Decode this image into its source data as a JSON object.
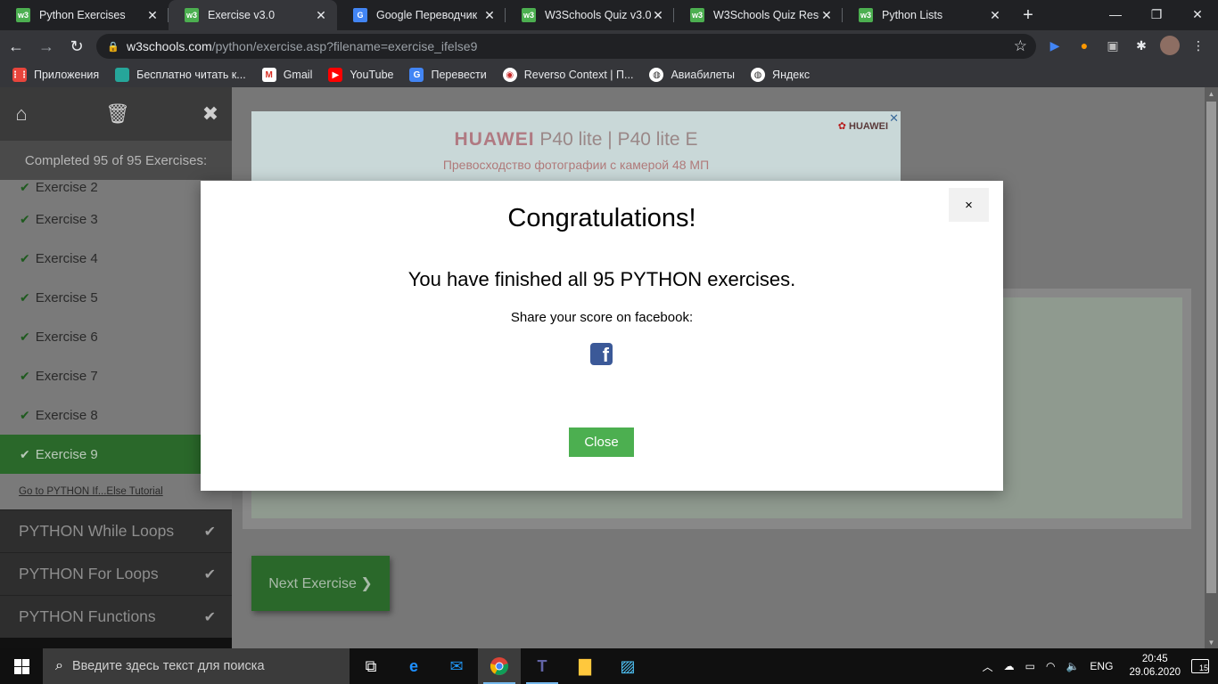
{
  "tabs": [
    {
      "title": "Python Exercises",
      "favicon": "w3"
    },
    {
      "title": "Exercise v3.0",
      "favicon": "w3",
      "active": true
    },
    {
      "title": "Google Переводчик",
      "favicon": "gt"
    },
    {
      "title": "W3Schools Quiz v3.0",
      "favicon": "w3"
    },
    {
      "title": "W3Schools Quiz Result",
      "favicon": "w3"
    },
    {
      "title": "Python Lists",
      "favicon": "w3"
    }
  ],
  "address": {
    "domain": "w3schools.com",
    "path": "/python/exercise.asp?filename=exercise_ifelse9"
  },
  "bookmarks": [
    {
      "label": "Приложения",
      "icon": "apps-grid-icon",
      "color": "#e8453c"
    },
    {
      "label": "Бесплатно читать к...",
      "icon": "book-icon",
      "color": "#26a69a"
    },
    {
      "label": "Gmail",
      "icon": "gmail-icon",
      "color": "#d93025"
    },
    {
      "label": "YouTube",
      "icon": "youtube-icon",
      "color": "#ff0000"
    },
    {
      "label": "Перевести",
      "icon": "translate-icon",
      "color": "#4285f4"
    },
    {
      "label": "Reverso Context | П...",
      "icon": "reverso-icon",
      "color": "#ffffff"
    },
    {
      "label": "Авиабилеты",
      "icon": "globe-icon",
      "color": "#ffffff"
    },
    {
      "label": "Яндекс",
      "icon": "globe-icon",
      "color": "#ffffff"
    }
  ],
  "sidebar": {
    "completed": "Completed 95 of 95 Exercises:",
    "exercises": [
      "Exercise 2",
      "Exercise 3",
      "Exercise 4",
      "Exercise 5",
      "Exercise 6",
      "Exercise 7",
      "Exercise 8",
      "Exercise 9"
    ],
    "active_exercise": "Exercise 9",
    "tutorial_link": "Go to PYTHON If...Else Tutorial",
    "sections": [
      "PYTHON While Loops",
      "PYTHON For Loops",
      "PYTHON Functions"
    ]
  },
  "ad": {
    "brand": "HUAWEI",
    "title_rest": "P40 lite | P40 lite E",
    "subtitle": "Превосходство фотографии с камерой 48 МП",
    "logo": "HUAWEI"
  },
  "next_button": "Next Exercise ❯",
  "modal": {
    "title": "Congratulations!",
    "message": "You have finished all 95 PYTHON exercises.",
    "share": "Share your score on facebook:",
    "close_label": "Close",
    "close_x": "×"
  },
  "taskbar": {
    "search_placeholder": "Введите здесь текст для поиска",
    "language": "ENG",
    "time": "20:45",
    "date": "29.06.2020",
    "notifications": "15"
  },
  "colors": {
    "accent": "#4caf50",
    "facebook": "#3b5998",
    "active_exercise": "#2a682a"
  }
}
